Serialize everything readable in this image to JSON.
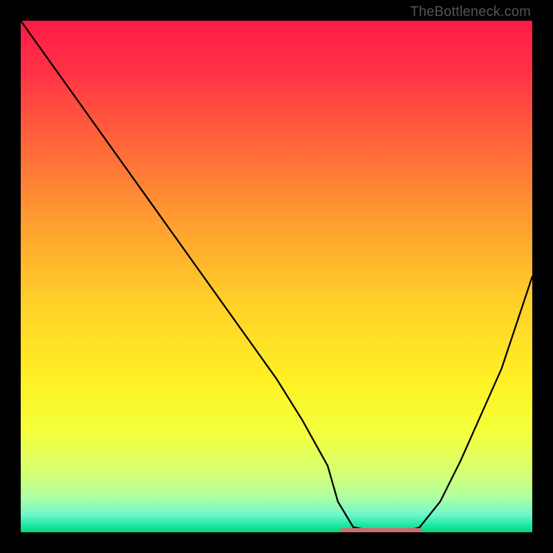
{
  "watermark": "TheBottleneck.com",
  "chart_data": {
    "type": "line",
    "title": "",
    "xlabel": "",
    "ylabel": "",
    "xlim": [
      0,
      100
    ],
    "ylim": [
      0,
      100
    ],
    "grid": false,
    "legend": false,
    "annotations": [],
    "series": [
      {
        "name": "bottleneck-curve",
        "x": [
          0,
          5,
          10,
          15,
          20,
          25,
          30,
          35,
          40,
          45,
          50,
          55,
          60,
          62,
          65,
          70,
          75,
          78,
          82,
          86,
          90,
          94,
          97,
          100
        ],
        "values": [
          100,
          93,
          86,
          79,
          72,
          65,
          58,
          51,
          44,
          37,
          30,
          22,
          13,
          6,
          1,
          0,
          0,
          1,
          6,
          14,
          23,
          32,
          41,
          50
        ]
      }
    ],
    "optimal_range": {
      "x_start": 63,
      "x_end": 78,
      "y": 0
    },
    "gradient_stops": [
      {
        "offset": 0.0,
        "color": "#ff1a47"
      },
      {
        "offset": 0.1,
        "color": "#ff3245"
      },
      {
        "offset": 0.25,
        "color": "#ff6a3a"
      },
      {
        "offset": 0.4,
        "color": "#ffa030"
      },
      {
        "offset": 0.55,
        "color": "#ffd028"
      },
      {
        "offset": 0.7,
        "color": "#fff024"
      },
      {
        "offset": 0.8,
        "color": "#f4ff3a"
      },
      {
        "offset": 0.88,
        "color": "#d8ff70"
      },
      {
        "offset": 0.93,
        "color": "#b0ffa0"
      },
      {
        "offset": 0.965,
        "color": "#70f8c8"
      },
      {
        "offset": 0.985,
        "color": "#20e8a8"
      },
      {
        "offset": 1.0,
        "color": "#00d878"
      }
    ]
  }
}
